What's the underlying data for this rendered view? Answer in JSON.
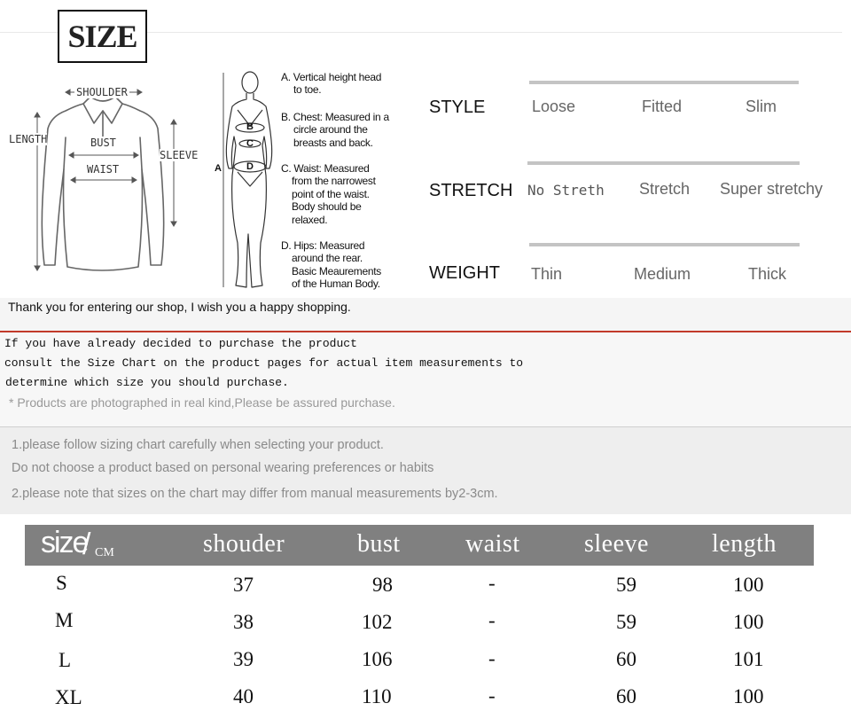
{
  "header": {
    "title": "SIZE"
  },
  "garment": {
    "labels": {
      "shoulder": "SHOULDER",
      "length": "LENGTH",
      "bust": "BUST",
      "waist": "WAIST",
      "sleeve": "SLEEVE"
    }
  },
  "body_figure": {
    "labels": {
      "a": "A",
      "b": "B",
      "c": "C",
      "d": "D"
    }
  },
  "measure_notes": [
    {
      "title": "A. Vertical height head",
      "body": "to toe."
    },
    {
      "title": "B. Chest: Measured in a",
      "body": "circle around the\nbreasts and back."
    },
    {
      "title": "C. Waist: Measured",
      "body": "from the narrowest\npoint of the waist.\nBody should be\nrelaxed."
    },
    {
      "title": "D. Hips: Measured",
      "body": "around the rear.\nBasic Meaurements\nof the Human Body."
    }
  ],
  "scales": [
    {
      "label": "STYLE",
      "options": [
        "Loose",
        "Fitted",
        "Slim"
      ]
    },
    {
      "label": "STRETCH",
      "options": [
        "No Streth",
        "Stretch",
        "Super stretchy"
      ]
    },
    {
      "label": "WEIGHT",
      "options": [
        "Thin",
        "Medium",
        "Thick"
      ]
    }
  ],
  "notices": {
    "thanks": "Thank you for entering our shop, I wish you a happy shopping.",
    "purchase_lines": [
      "If you have already decided to purchase the product",
      "consult the Size Chart on the product pages for actual item measurements to",
      "determine which size you should purchase."
    ],
    "products_note": "* Products are photographed in real kind,Please be assured purchase.",
    "tips": [
      "1.please follow sizing chart carefully when selecting your product.",
      "Do not choose a product based on personal wearing preferences or habits",
      "2.please note that sizes on the chart may differ from manual measurements by2-3cm."
    ]
  },
  "size_table": {
    "size_label": "size",
    "slash": "/",
    "unit": "CM",
    "columns": [
      "shouder",
      "bust",
      "waist",
      "sleeve",
      "length"
    ],
    "rows": [
      {
        "size": "S",
        "shouder": "37",
        "bust": "98",
        "waist": "-",
        "sleeve": "59",
        "length": "100"
      },
      {
        "size": "M",
        "shouder": "38",
        "bust": "102",
        "waist": "-",
        "sleeve": "59",
        "length": "100"
      },
      {
        "size": "L",
        "shouder": "39",
        "bust": "106",
        "waist": "-",
        "sleeve": "60",
        "length": "101"
      },
      {
        "size": "XL",
        "shouder": "40",
        "bust": "110",
        "waist": "-",
        "sleeve": "60",
        "length": "100"
      }
    ]
  }
}
